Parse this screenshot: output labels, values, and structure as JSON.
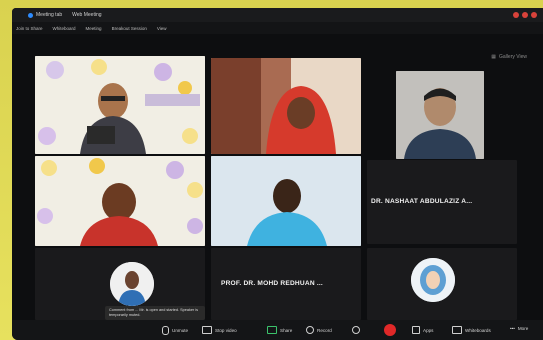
{
  "window": {
    "tabs": [
      "Meeting tab",
      "Web Meeting"
    ],
    "menu": [
      "Join to Share",
      "Whiteboard",
      "Meeting",
      "Breakout Session",
      "View"
    ],
    "view_label": "Gallery View"
  },
  "participants": [
    {
      "id": "p1",
      "label": ""
    },
    {
      "id": "p2",
      "label": ""
    },
    {
      "id": "p3",
      "label": ""
    },
    {
      "id": "p4",
      "label": ""
    },
    {
      "id": "p5",
      "label": ""
    },
    {
      "id": "p6",
      "label": "DR. NASHAAT ABDULAZIZ A..."
    },
    {
      "id": "p7",
      "label": ""
    },
    {
      "id": "p8",
      "label": "PROF. DR. MOHD REDHUAN ..."
    },
    {
      "id": "p9",
      "label": ""
    }
  ],
  "tooltip": {
    "text": "Comment from ... Mr. is open and started. Speaker is temporarily muted."
  },
  "controls": {
    "unmute": "Unmute",
    "start_video": "Stop video",
    "share": "Share",
    "record": "Record",
    "reactions": "",
    "leave": "",
    "apps": "Apps",
    "whiteboards": "Whiteboards",
    "more": "More"
  },
  "colors": {
    "accent": "#2d8cff",
    "record": "#e02828",
    "frame": "#e4dd5a"
  },
  "icons": [
    "mic-icon",
    "video-icon",
    "share-icon",
    "record-icon",
    "apps-icon",
    "whiteboard-icon",
    "more-icon"
  ]
}
